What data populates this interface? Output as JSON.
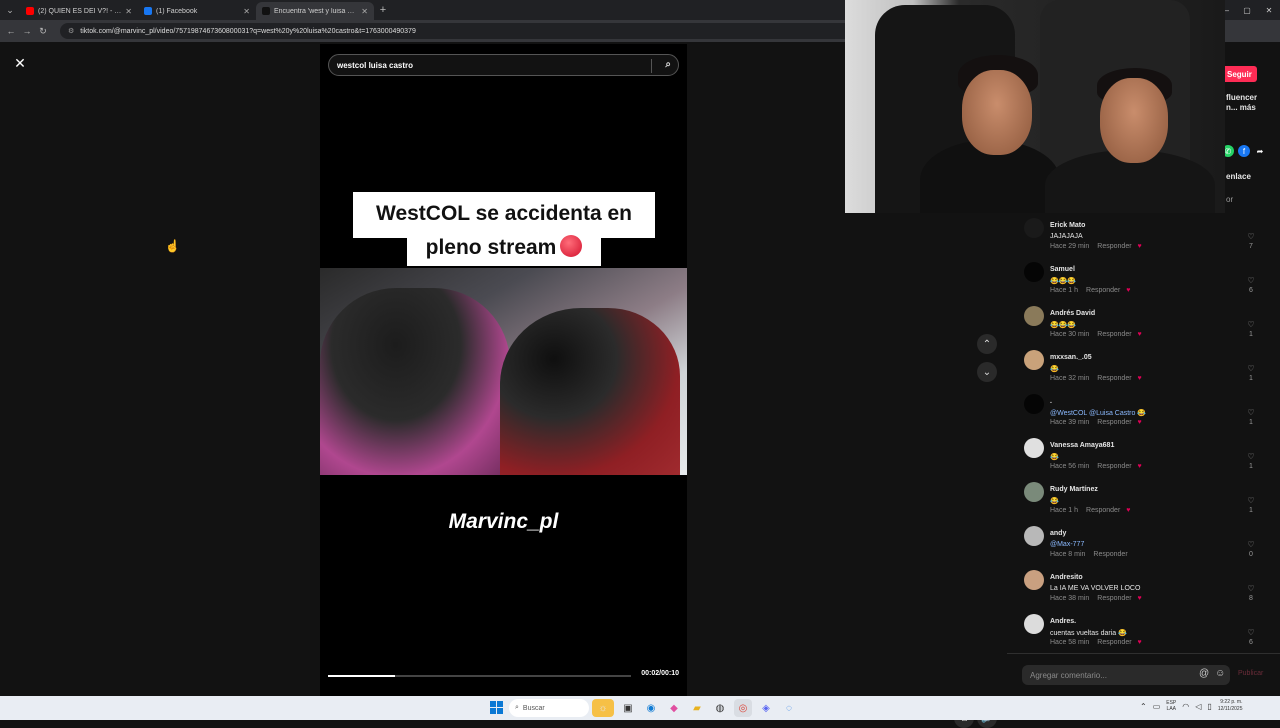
{
  "browser": {
    "tabs": [
      {
        "title": "(2) QUIEN ES DEI V?! - DEI V (F...",
        "favicon_color": "#ff0000",
        "active": false
      },
      {
        "title": "(1) Facebook",
        "favicon_color": "#1877f2",
        "active": false
      },
      {
        "title": "Encuentra 'west y luisa cast...",
        "favicon_color": "#111111",
        "active": true
      }
    ],
    "url": "tiktok.com/@marvinc_pl/video/7571987467360800031?q=west%20y%20luisa%20castro&t=1763000490379"
  },
  "player": {
    "search_value": "westcol luisa castro",
    "caption_line1": "WestCOL se accidenta en",
    "caption_line2": "pleno stream",
    "watermark": "Marvinc_pl",
    "time": "00:02/00:10",
    "progress": 0.22
  },
  "side_panel": {
    "follow_label": "Seguir",
    "text1": "fluencer",
    "text2": "n... más",
    "text3": "enlace",
    "text4": "or"
  },
  "comments": [
    {
      "name": "Erick Mato",
      "text": "JAJAJAJA",
      "time": "Hace 29 min",
      "reply": "Responder",
      "likes": "7",
      "avatar": "#1a1a1a",
      "creator_like": true
    },
    {
      "name": "Samuel",
      "text": "😂😂😂",
      "time": "Hace 1 h",
      "reply": "Responder",
      "likes": "6",
      "avatar": "#050505",
      "creator_like": true
    },
    {
      "name": "Andrés David",
      "text": "😂😂😂",
      "time": "Hace 30 min",
      "reply": "Responder",
      "likes": "1",
      "avatar": "#8a7a5a",
      "creator_like": true
    },
    {
      "name": "mxxsan._.05",
      "text": "😂",
      "time": "Hace 32 min",
      "reply": "Responder",
      "likes": "1",
      "avatar": "#c9a27a",
      "creator_like": true
    },
    {
      "name": ".",
      "text": "@WestCOL @Luisa Castro 😂",
      "time": "Hace 39 min",
      "reply": "Responder",
      "likes": "1",
      "avatar": "#050505",
      "creator_like": true,
      "mention": true
    },
    {
      "name": "Vanessa Amaya681",
      "text": "😂",
      "time": "Hace 56 min",
      "reply": "Responder",
      "likes": "1",
      "avatar": "#e0e0e0",
      "creator_like": true
    },
    {
      "name": "Rudy Martínez",
      "text": "😂",
      "time": "Hace 1 h",
      "reply": "Responder",
      "likes": "1",
      "avatar": "#7a8a7a",
      "creator_like": true
    },
    {
      "name": "andy",
      "text": "@Max-777",
      "time": "Hace 8 min",
      "reply": "Responder",
      "likes": "0",
      "avatar": "#b8b8b8",
      "creator_like": false,
      "mention": true
    },
    {
      "name": "Andresito",
      "text": "La IA ME VA VOLVER LOCO",
      "time": "Hace 38 min",
      "reply": "Responder",
      "likes": "8",
      "avatar": "#c9a080",
      "creator_like": true
    },
    {
      "name": "Andres.",
      "text": "cuentas vueltas daria 😂",
      "time": "Hace 58 min",
      "reply": "Responder",
      "likes": "6",
      "avatar": "#dcdcdc",
      "creator_like": true
    }
  ],
  "comment_input": {
    "placeholder": "Agregar comentario...",
    "post_label": "Publicar"
  },
  "taskbar": {
    "search_placeholder": "Buscar",
    "lang_line1": "ESP",
    "lang_line2": "LAA",
    "time": "9:22 p. m.",
    "date": "12/11/2025"
  }
}
